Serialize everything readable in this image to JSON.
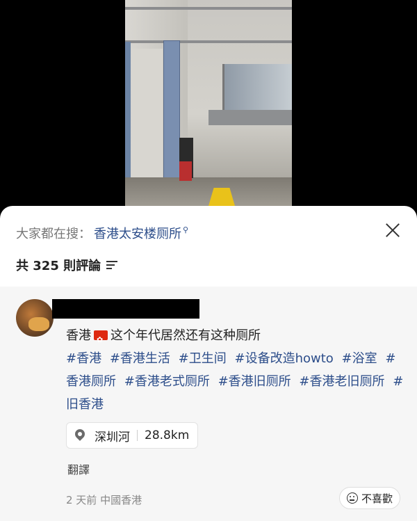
{
  "search": {
    "prefix": "大家都在搜：",
    "term": "香港太安楼厕所",
    "icon": "search-icon"
  },
  "comments_header": {
    "count_label": "共 325 則評論",
    "sort_icon": "sort-icon"
  },
  "comment": {
    "text_before_flag": "香港",
    "text_after_flag": "这个年代居然还有这种厕所",
    "hashtags": [
      "#香港",
      "#香港生活",
      "#卫生间",
      "#设备改造howto",
      "#浴室",
      "#香港厕所",
      "#香港老式厕所",
      "#香港旧厕所",
      "#香港老旧厕所",
      "#旧香港"
    ],
    "location_name": "深圳河",
    "location_distance": "28.8km",
    "translate_label": "翻譯",
    "meta": "2 天前  中國香港",
    "dislike_label": "不喜歡"
  },
  "colors": {
    "link": "#2c4d8a",
    "sheet_bg": "#ffffff",
    "comment_bg": "#f6f6f6"
  }
}
